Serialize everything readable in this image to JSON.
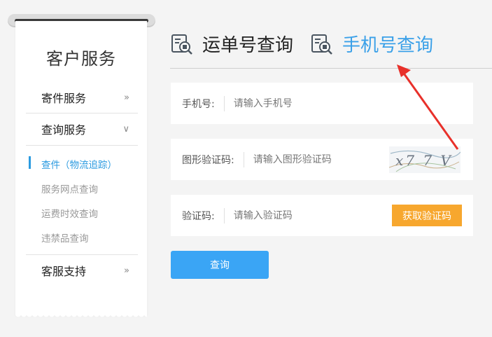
{
  "sidebar": {
    "title": "客户服务",
    "menu": [
      {
        "label": "寄件服务",
        "chevron": "»"
      },
      {
        "label": "查询服务",
        "chevron": "∨"
      },
      {
        "label": "客服支持",
        "chevron": "»"
      }
    ],
    "sub_items": [
      {
        "label": "查件（物流追踪）",
        "active": true
      },
      {
        "label": "服务网点查询",
        "active": false
      },
      {
        "label": "运费时效查询",
        "active": false
      },
      {
        "label": "违禁品查询",
        "active": false
      }
    ]
  },
  "tabs": [
    {
      "label": "运单号查询",
      "icon": "waybill-search-icon",
      "active": false
    },
    {
      "label": "手机号查询",
      "icon": "phone-search-icon",
      "active": true
    }
  ],
  "form": {
    "phone": {
      "label": "手机号:",
      "placeholder": "请输入手机号"
    },
    "captcha": {
      "label": "图形验证码:",
      "placeholder": "请输入图形验证码",
      "image_text": "x7 7 V"
    },
    "sms": {
      "label": "验证码:",
      "placeholder": "请输入验证码",
      "button": "获取验证码"
    },
    "submit": "查询"
  },
  "colors": {
    "accent": "#3aa5f5",
    "active_tab": "#3aa0e8",
    "orange_button": "#f7a72e",
    "annotation_arrow": "#e8302a"
  }
}
